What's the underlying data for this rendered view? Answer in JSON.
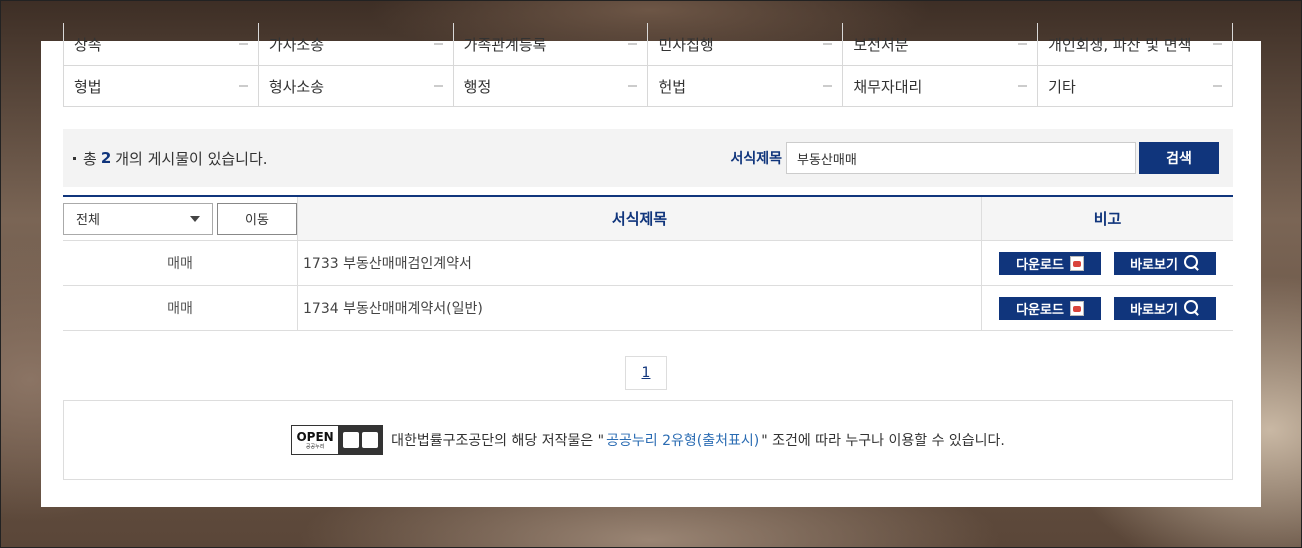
{
  "categories": {
    "row1": [
      "상속",
      "가사소송",
      "가족관계등록",
      "민사집행",
      "보전처분",
      "개인회생, 파산 및 면책"
    ],
    "row2": [
      "형법",
      "형사소송",
      "행정",
      "헌법",
      "채무자대리",
      "기타"
    ]
  },
  "summary": {
    "prefix": "총",
    "count": "2",
    "suffix": "개의 게시물이 있습니다."
  },
  "search": {
    "label": "서식제목",
    "value": "부동산매매",
    "button_label": "검색"
  },
  "table": {
    "filter_selected": "전체",
    "move_button_label": "이동",
    "headers": {
      "title": "서식제목",
      "note": "비고"
    },
    "rows": [
      {
        "category": "매매",
        "title": "1733 부동산매매검인계약서"
      },
      {
        "category": "매매",
        "title": "1734 부동산매매계약서(일반)"
      }
    ],
    "download_label": "다운로드",
    "view_label": "바로보기"
  },
  "pagination": {
    "current_page": "1"
  },
  "license": {
    "badge_text": "OPEN",
    "badge_subtext": "공공누리",
    "text_before": "대한법률구조공단의 해당 저작물은 \"",
    "link_text": "공공누리 2유형(출처표시)",
    "text_after": "\" 조건에 따라 누구나 이용할 수 있습니다."
  },
  "colors": {
    "primary": "#10357c",
    "link": "#2b6cb3",
    "search_bar_bg": "#f3f3f3"
  }
}
